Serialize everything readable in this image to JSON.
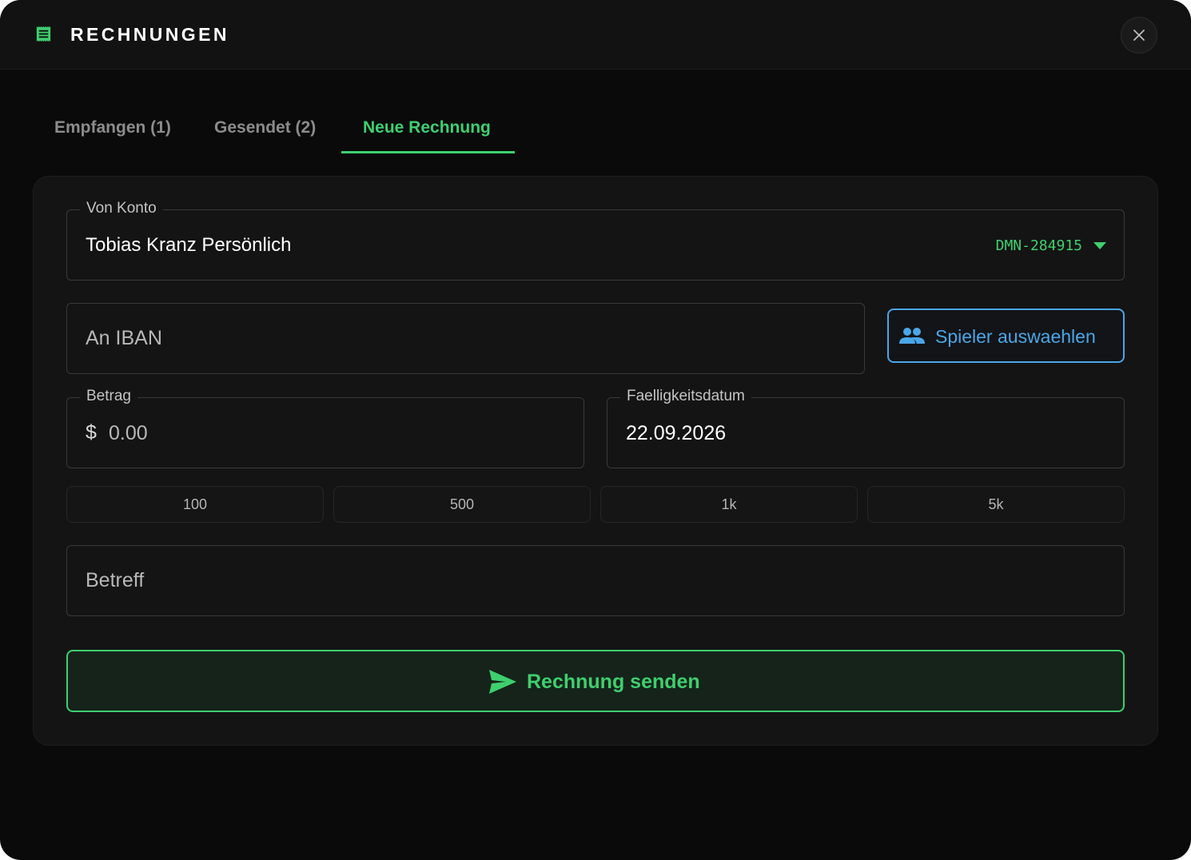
{
  "header": {
    "title": "RECHNUNGEN",
    "icon": "receipt-icon",
    "close_icon": "close-icon"
  },
  "tabs": [
    {
      "label": "Empfangen (1)",
      "active": false
    },
    {
      "label": "Gesendet (2)",
      "active": false
    },
    {
      "label": "Neue Rechnung",
      "active": true
    }
  ],
  "form": {
    "account": {
      "label": "Von Konto",
      "value": "Tobias Kranz Persönlich",
      "account_id": "DMN-284915"
    },
    "iban": {
      "placeholder": "An IBAN"
    },
    "player_button": {
      "label": "Spieler auswaehlen",
      "icon": "people-icon"
    },
    "amount": {
      "label": "Betrag",
      "currency": "$",
      "placeholder": "0.00"
    },
    "due_date": {
      "label": "Faelligkeitsdatum",
      "value": "22.09.2026"
    },
    "quick_amounts": [
      "100",
      "500",
      "1k",
      "5k"
    ],
    "subject": {
      "placeholder": "Betreff"
    },
    "submit": {
      "label": "Rechnung senden",
      "icon": "send-icon"
    }
  },
  "colors": {
    "accent": "#3ecf6e",
    "secondary": "#4aa6e8",
    "background": "#0a0a0a",
    "card": "#141414"
  }
}
